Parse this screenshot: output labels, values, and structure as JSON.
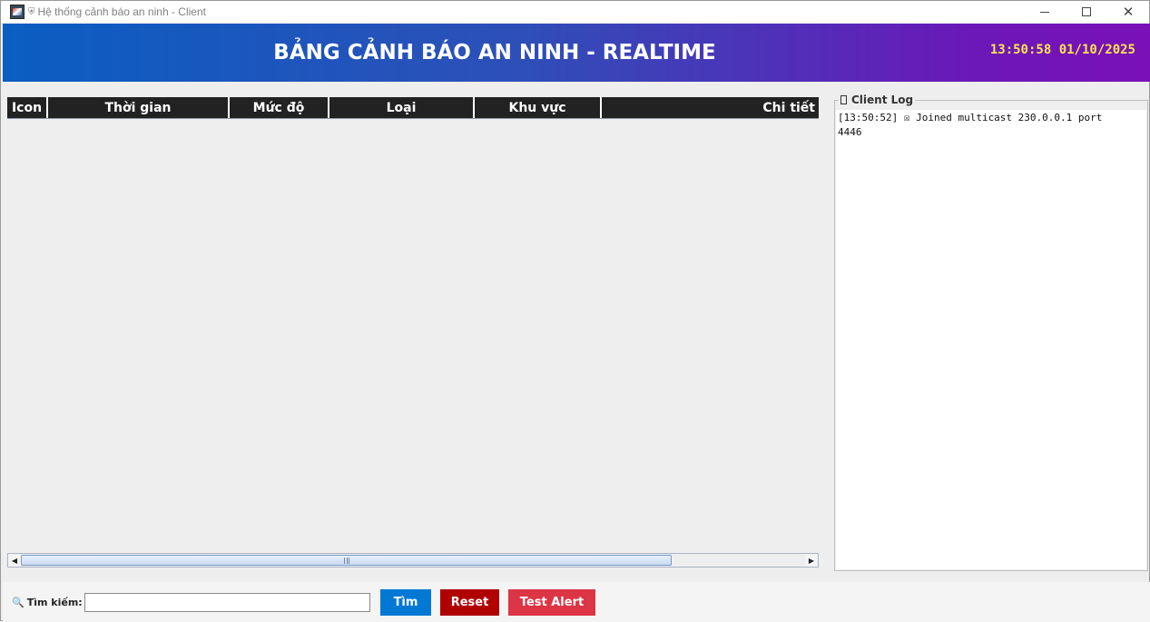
{
  "window": {
    "title": "Hệ thống cảnh báo an ninh - Client",
    "shield_glyph": "⛨"
  },
  "banner": {
    "title": "BẢNG CẢNH BÁO AN NINH - REALTIME",
    "clock": "13:50:58 01/10/2025",
    "colors": {
      "gradient_start": "#0a5ec2",
      "gradient_end": "#7a10b8",
      "clock": "#ffe44d"
    }
  },
  "table": {
    "columns": [
      "Icon",
      "Thời gian",
      "Mức độ",
      "Loại",
      "Khu vực",
      "Chi tiết"
    ],
    "rows": []
  },
  "log": {
    "title": "Client Log",
    "lines": "[13:50:52] ☒ Joined multicast 230.0.0.1 port\n4446"
  },
  "search": {
    "label": "Tìm kiếm:",
    "value": "",
    "placeholder": ""
  },
  "buttons": {
    "search": {
      "label": "Tìm",
      "color": "#0078d4"
    },
    "reset": {
      "label": "Reset",
      "color": "#b00000"
    },
    "test_alert": {
      "label": "Test Alert",
      "color": "#dc3545"
    }
  }
}
